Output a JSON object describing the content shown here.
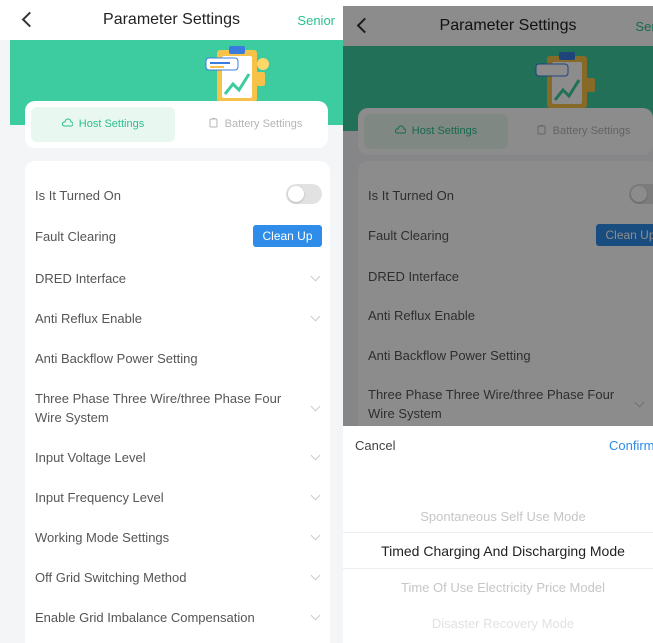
{
  "header": {
    "title": "Parameter Settings",
    "senior_label": "Senior"
  },
  "tabs": [
    {
      "label": "Host Settings",
      "icon": "cloud-icon",
      "active": true
    },
    {
      "label": "Battery Settings",
      "icon": "battery-icon",
      "active": false
    }
  ],
  "settings": [
    {
      "label": "Is It Turned On",
      "control": "toggle",
      "value": false
    },
    {
      "label": "Fault Clearing",
      "control": "button",
      "button_label": "Clean Up"
    },
    {
      "label": "DRED Interface",
      "control": "dropdown"
    },
    {
      "label": "Anti Reflux Enable",
      "control": "dropdown"
    },
    {
      "label": "Anti Backflow Power Setting",
      "control": "none"
    },
    {
      "label": "Three Phase Three Wire/three Phase Four Wire System",
      "control": "dropdown"
    },
    {
      "label": "Input Voltage Level",
      "control": "dropdown"
    },
    {
      "label": "Input Frequency Level",
      "control": "dropdown"
    },
    {
      "label": "Working Mode Settings",
      "control": "dropdown"
    },
    {
      "label": "Off Grid Switching Method",
      "control": "dropdown"
    },
    {
      "label": "Enable Grid Imbalance Compensation",
      "control": "dropdown"
    }
  ],
  "picker": {
    "cancel_label": "Cancel",
    "confirm_label": "Confirm",
    "options": [
      "Spontaneous Self Use Mode",
      "Timed Charging And Discharging Mode",
      "Time Of Use Electricity Price Model",
      "Disaster Recovery Mode"
    ],
    "selected": "Timed Charging And Discharging Mode"
  },
  "colors": {
    "accent": "#3ccc9f",
    "link": "#2bbf8e",
    "button": "#2f8ce8"
  }
}
